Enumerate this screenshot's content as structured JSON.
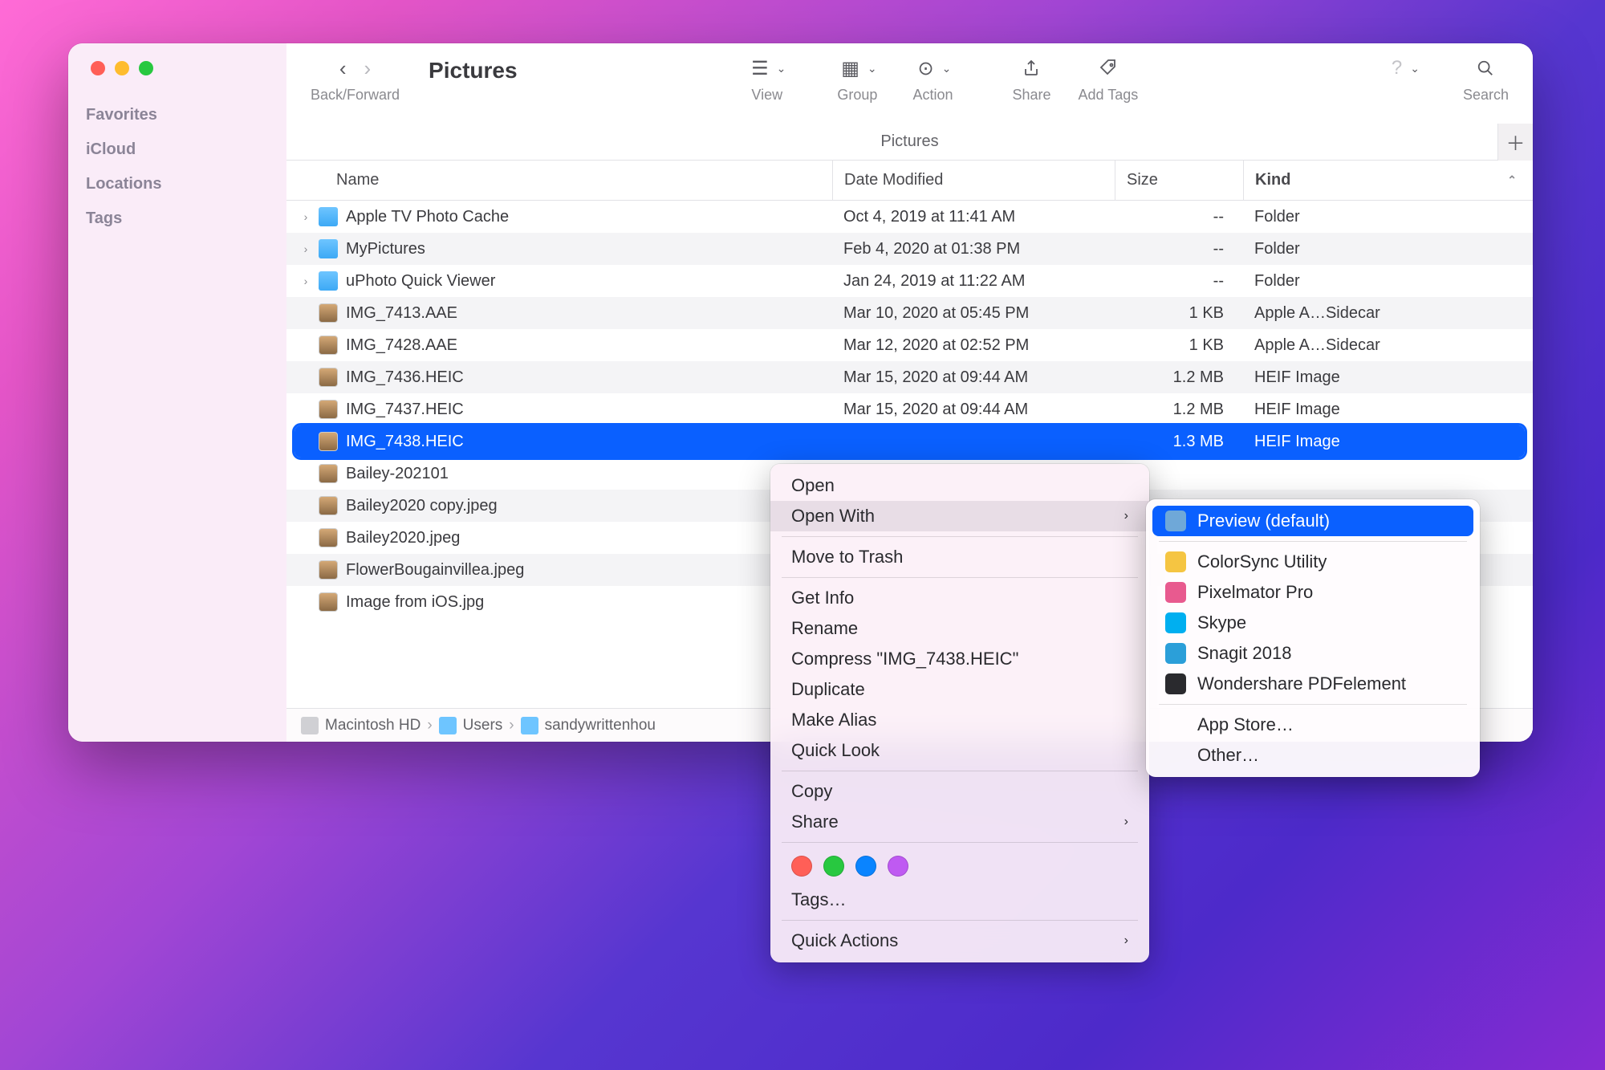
{
  "window_title": "Pictures",
  "toolbar": {
    "back_forward_label": "Back/Forward",
    "view_label": "View",
    "group_label": "Group",
    "action_label": "Action",
    "share_label": "Share",
    "add_tags_label": "Add Tags",
    "search_label": "Search"
  },
  "location_bar_title": "Pictures",
  "sidebar": {
    "sections": [
      "Favorites",
      "iCloud",
      "Locations",
      "Tags"
    ]
  },
  "columns": {
    "name": "Name",
    "date": "Date Modified",
    "size": "Size",
    "kind": "Kind"
  },
  "files": [
    {
      "name": "Apple TV Photo Cache",
      "date": "Oct 4, 2019 at 11:41 AM",
      "size": "--",
      "kind": "Folder",
      "type": "folder",
      "expandable": true
    },
    {
      "name": "MyPictures",
      "date": "Feb 4, 2020 at 01:38 PM",
      "size": "--",
      "kind": "Folder",
      "type": "folder",
      "expandable": true
    },
    {
      "name": "uPhoto Quick Viewer",
      "date": "Jan 24, 2019 at 11:22 AM",
      "size": "--",
      "kind": "Folder",
      "type": "folder",
      "expandable": true
    },
    {
      "name": "IMG_7413.AAE",
      "date": "Mar 10, 2020 at 05:45 PM",
      "size": "1 KB",
      "kind": "Apple A…Sidecar",
      "type": "file"
    },
    {
      "name": "IMG_7428.AAE",
      "date": "Mar 12, 2020 at 02:52 PM",
      "size": "1 KB",
      "kind": "Apple A…Sidecar",
      "type": "file"
    },
    {
      "name": "IMG_7436.HEIC",
      "date": "Mar 15, 2020 at 09:44 AM",
      "size": "1.2 MB",
      "kind": "HEIF Image",
      "type": "image"
    },
    {
      "name": "IMG_7437.HEIC",
      "date": "Mar 15, 2020 at 09:44 AM",
      "size": "1.2 MB",
      "kind": "HEIF Image",
      "type": "image"
    },
    {
      "name": "IMG_7438.HEIC",
      "date": "",
      "size": "1.3 MB",
      "kind": "HEIF Image",
      "type": "image",
      "selected": true
    },
    {
      "name": "Bailey-202101",
      "date": "",
      "size": "",
      "kind": "",
      "type": "image"
    },
    {
      "name": "Bailey2020 copy.jpeg",
      "date": "",
      "size": "",
      "kind": "",
      "type": "image"
    },
    {
      "name": "Bailey2020.jpeg",
      "date": "",
      "size": "",
      "kind": "",
      "type": "image"
    },
    {
      "name": "FlowerBougainvillea.jpeg",
      "date": "",
      "size": "",
      "kind": "",
      "type": "image"
    },
    {
      "name": "Image from iOS.jpg",
      "date": "",
      "size": "",
      "kind": "",
      "type": "image"
    }
  ],
  "path_bar": [
    "Macintosh HD",
    "Users",
    "sandywrittenhou"
  ],
  "context_menu": {
    "items": [
      {
        "label": "Open"
      },
      {
        "label": "Open With",
        "submenu": true,
        "highlighted": true
      },
      {
        "sep": true
      },
      {
        "label": "Move to Trash"
      },
      {
        "sep": true
      },
      {
        "label": "Get Info"
      },
      {
        "label": "Rename"
      },
      {
        "label": "Compress \"IMG_7438.HEIC\""
      },
      {
        "label": "Duplicate"
      },
      {
        "label": "Make Alias"
      },
      {
        "label": "Quick Look"
      },
      {
        "sep": true
      },
      {
        "label": "Copy"
      },
      {
        "label": "Share",
        "submenu": true
      },
      {
        "sep": true
      },
      {
        "tags": true
      },
      {
        "label": "Tags…"
      },
      {
        "sep": true
      },
      {
        "label": "Quick Actions",
        "submenu": true
      }
    ],
    "tag_colors": [
      "#ff5f57",
      "#28c840",
      "#0a84ff",
      "#bf5af2"
    ]
  },
  "submenu": {
    "items": [
      {
        "label": "Preview (default)",
        "selected": true,
        "color": "#6fa8d8"
      },
      {
        "sep": true
      },
      {
        "label": "ColorSync Utility",
        "color": "#f5c542"
      },
      {
        "label": "Pixelmator Pro",
        "color": "#e85a8f"
      },
      {
        "label": "Skype",
        "color": "#00aff0"
      },
      {
        "label": "Snagit 2018",
        "color": "#2b9fd9"
      },
      {
        "label": "Wondershare PDFelement",
        "color": "#2a2a2e"
      },
      {
        "sep": true
      },
      {
        "label": "App Store…"
      },
      {
        "label": "Other…"
      }
    ]
  }
}
